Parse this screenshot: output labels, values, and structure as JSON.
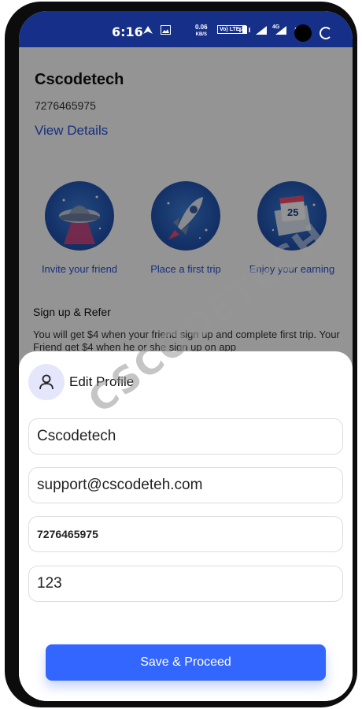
{
  "status_bar": {
    "time": "6:16",
    "speed_value": "0.06",
    "speed_unit": "KB/S",
    "volte": "Vo) LTE 2",
    "network": "4G",
    "battery": "5"
  },
  "profile": {
    "name": "Cscodetech",
    "phone": "7276465975",
    "view_details": "View Details"
  },
  "features": [
    {
      "label": "Invite your friend",
      "icon": "ufo-icon"
    },
    {
      "label": "Place a first trip",
      "icon": "rocket-icon"
    },
    {
      "label": "Enjoy your earning",
      "icon": "calendar-envelope-icon",
      "badge": "25"
    }
  ],
  "refer": {
    "title": "Sign up & Refer",
    "text": "You will get $4 when your friend sign up and complete first trip. Your Friend get $4 when he or she sign up on app"
  },
  "edit_profile": {
    "title": "Edit Profile",
    "icon": "user-icon",
    "name_value": "Cscodetech",
    "email_value": "support@cscodeteh.com",
    "phone_value": "7276465975",
    "code_value": "123",
    "save_label": "Save & Proceed"
  },
  "watermark": "CSCODETECH",
  "colors": {
    "status_bar": "#163089",
    "link": "#2554d9",
    "primary_button": "#3366ff",
    "avatar_bg": "#e4e6fb"
  }
}
